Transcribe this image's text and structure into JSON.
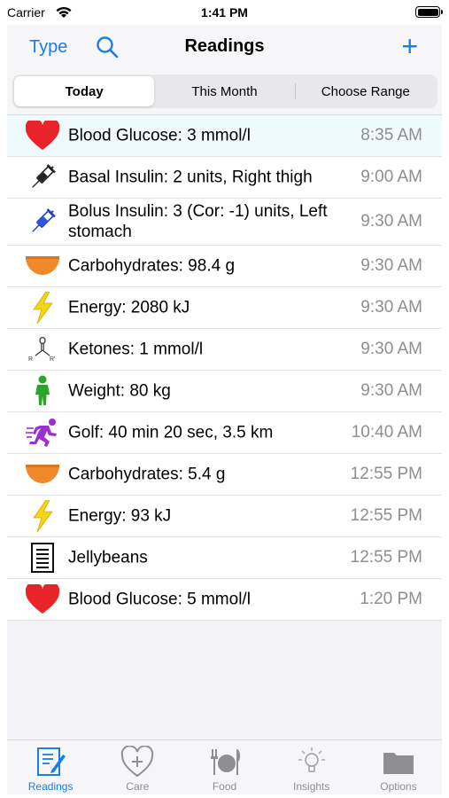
{
  "status_bar": {
    "carrier": "Carrier",
    "time": "1:41 PM"
  },
  "navbar": {
    "type_label": "Type",
    "title": "Readings",
    "add_label": "+"
  },
  "segments": [
    {
      "label": "Today",
      "selected": true
    },
    {
      "label": "This Month",
      "selected": false
    },
    {
      "label": "Choose Range",
      "selected": false
    }
  ],
  "readings": [
    {
      "icon": "heart-icon",
      "label": "Blood Glucose: 3 mmol/l",
      "time": "8:35 AM"
    },
    {
      "icon": "syringe-black-icon",
      "label": "Basal Insulin: 2 units, Right thigh",
      "time": "9:00 AM"
    },
    {
      "icon": "syringe-blue-icon",
      "label": "Bolus Insulin: 3 (Cor: -1) units, Left stomach",
      "time": "9:30 AM"
    },
    {
      "icon": "bowl-icon",
      "label": "Carbohydrates: 98.4 g",
      "time": "9:30 AM"
    },
    {
      "icon": "lightning-icon",
      "label": "Energy: 2080 kJ",
      "time": "9:30 AM"
    },
    {
      "icon": "ketone-molecule-icon",
      "label": "Ketones: 1 mmol/l",
      "time": "9:30 AM"
    },
    {
      "icon": "person-icon",
      "label": "Weight: 80 kg",
      "time": "9:30 AM"
    },
    {
      "icon": "runner-icon",
      "label": "Golf: 40 min 20 sec, 3.5 km",
      "time": "10:40 AM"
    },
    {
      "icon": "bowl-icon",
      "label": "Carbohydrates: 5.4 g",
      "time": "12:55 PM"
    },
    {
      "icon": "lightning-icon",
      "label": "Energy: 93 kJ",
      "time": "12:55 PM"
    },
    {
      "icon": "document-icon",
      "label": "Jellybeans",
      "time": "12:55 PM"
    },
    {
      "icon": "heart-icon",
      "label": "Blood Glucose: 5 mmol/l",
      "time": "1:20 PM"
    }
  ],
  "ketone_icon_text": {
    "left": "R",
    "right": "R'"
  },
  "tabs": [
    {
      "icon": "readings-icon",
      "label": "Readings",
      "active": true
    },
    {
      "icon": "care-icon",
      "label": "Care",
      "active": false
    },
    {
      "icon": "food-icon",
      "label": "Food",
      "active": false
    },
    {
      "icon": "insights-icon",
      "label": "Insights",
      "active": false
    },
    {
      "icon": "options-folder-icon",
      "label": "Options",
      "active": false
    }
  ],
  "colors": {
    "accent": "#1a7ee8",
    "heart": "#e8232a",
    "bowl": "#f0892a",
    "lightning": "#f5d316",
    "person": "#2aa52a",
    "runner": "#9b2fd6",
    "highlight_row": "#eefafc"
  }
}
